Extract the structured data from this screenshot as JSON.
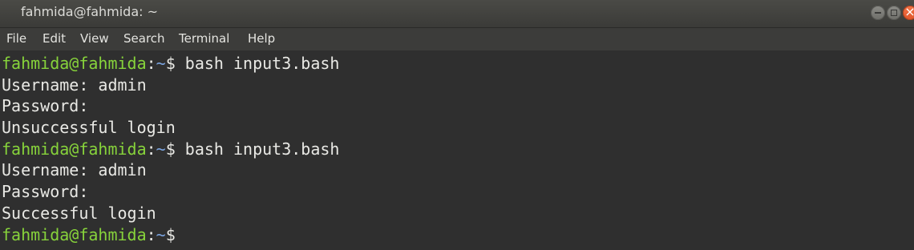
{
  "window": {
    "title": "fahmida@fahmida: ~"
  },
  "menu": {
    "items": [
      "File",
      "Edit",
      "View",
      "Search",
      "Terminal",
      "Help"
    ]
  },
  "terminal": {
    "colors": {
      "background": "#2f2f2f",
      "text": "#e9e9e5",
      "user": "#87d33b",
      "path": "#7ba4e0"
    },
    "prompt_user": "fahmida@fahmida",
    "prompt_colon": ":",
    "prompt_path": "~",
    "prompt_symbol": "$",
    "lines": [
      {
        "type": "prompt",
        "command": " bash input3.bash"
      },
      {
        "type": "output",
        "text": "Username: admin"
      },
      {
        "type": "output",
        "text": "Password:"
      },
      {
        "type": "output",
        "text": "Unsuccessful login"
      },
      {
        "type": "prompt",
        "command": " bash input3.bash"
      },
      {
        "type": "output",
        "text": "Username: admin"
      },
      {
        "type": "output",
        "text": "Password:"
      },
      {
        "type": "output",
        "text": "Successful login"
      },
      {
        "type": "prompt",
        "command": ""
      }
    ]
  }
}
